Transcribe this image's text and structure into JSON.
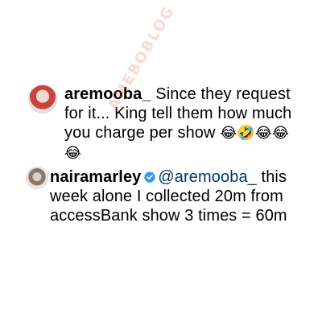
{
  "comments": [
    {
      "username": "aremooba_",
      "text": " Since they request for it... King tell them how much you charge per show ",
      "emoji": "😂🤣😂😂😂"
    },
    {
      "username": "nairamarley",
      "verified": true,
      "mention": "@aremooba_",
      "text": " this week alone I collected 20m from accessBank show 3 times = 60m"
    }
  ],
  "watermark": "AMEBOBLOG"
}
